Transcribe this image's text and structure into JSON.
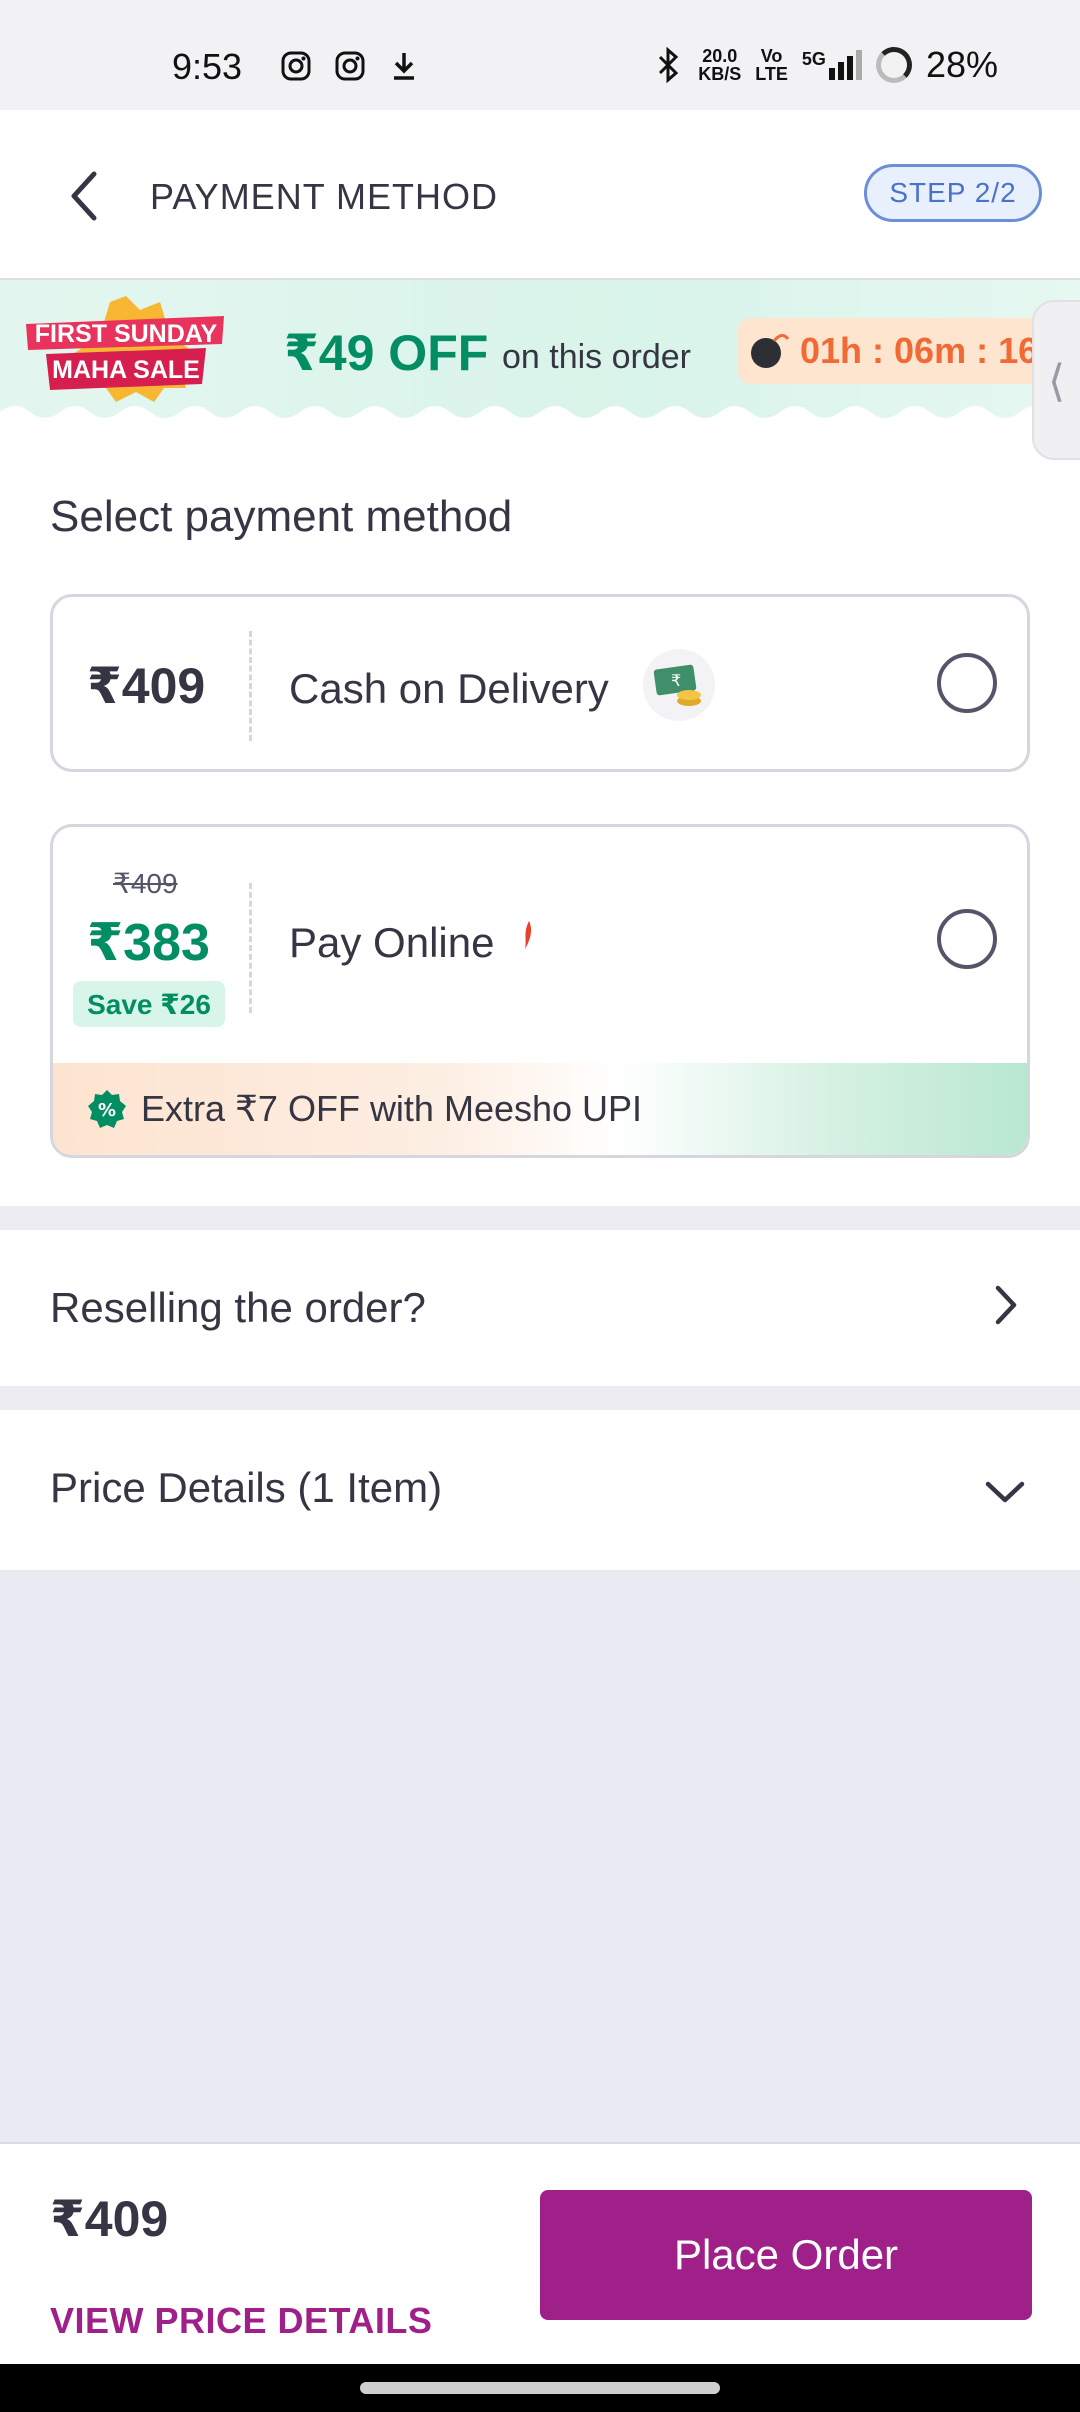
{
  "status_bar": {
    "time": "9:53",
    "net_speed_value": "20.0",
    "net_speed_unit": "KB/S",
    "volte_top": "Vo",
    "volte_bottom": "LTE",
    "network": "5G",
    "battery": "28%",
    "icons": [
      "instagram-icon",
      "instagram-icon",
      "download-icon",
      "bluetooth-icon",
      "signal-icon"
    ]
  },
  "header": {
    "title": "PAYMENT METHOD",
    "step": "STEP 2/2",
    "back_icon": "chevron-left-icon"
  },
  "sale_banner": {
    "logo_line1": "FIRST SUNDAY",
    "logo_line2": "MAHA SALE",
    "offer": "₹49 OFF",
    "offer_suffix": "on this order",
    "timer": "01h : 06m : 16",
    "colors": {
      "green": "#038d63",
      "orange": "#f16a36"
    }
  },
  "section": {
    "title": "Select payment method"
  },
  "payment_options": {
    "cod": {
      "price": "₹409",
      "label": "Cash on Delivery",
      "icon": "cash-icon"
    },
    "online": {
      "original_price": "₹409",
      "price": "₹383",
      "save": "Save ₹26",
      "label": "Pay Online",
      "upi_offer": "Extra ₹7 OFF with Meesho UPI"
    }
  },
  "rows": {
    "reselling": "Reselling the order?",
    "price_details": "Price Details (1 Item)"
  },
  "bottom_bar": {
    "total": "₹409",
    "view_details": "VIEW PRICE DETAILS",
    "place_order": "Place Order",
    "accent": "#9f2089"
  }
}
